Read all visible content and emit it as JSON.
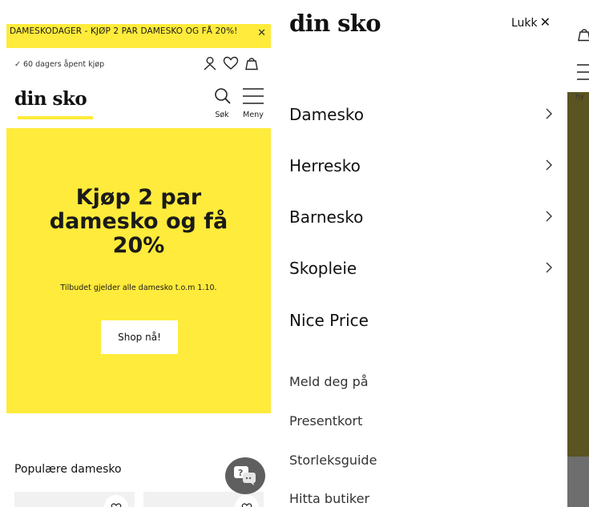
{
  "left_page": {
    "promo_banner": {
      "text": "DAMESKODAGER - KJØP 2 PAR DAMESKO OG FÅ 20%!",
      "close_glyph": "✕"
    },
    "trust_text": "60 dagers åpent kjøp",
    "trust_icon": "checkmark-icon",
    "header_icons": [
      "user-icon",
      "heart-icon",
      "bag-icon"
    ],
    "logo": "din sko",
    "search_label": "Søk",
    "menu_label": "Meny",
    "hero": {
      "title": "Kjøp 2 par damesko og få 20%",
      "subtitle": "Tilbudet gjelder alle damesko t.o.m 1.10.",
      "button": "Shop nå!"
    },
    "popular_heading": "Populære damesko"
  },
  "drawer": {
    "logo": "din sko",
    "close_label": "Lukk",
    "close_glyph": "✕",
    "primary_items": [
      {
        "label": "Damesko",
        "has_submenu": true
      },
      {
        "label": "Herresko",
        "has_submenu": true
      },
      {
        "label": "Barnesko",
        "has_submenu": true
      },
      {
        "label": "Skopleie",
        "has_submenu": true
      },
      {
        "label": "Nice Price",
        "has_submenu": false
      }
    ],
    "secondary_items": [
      {
        "label": "Meld deg på"
      },
      {
        "label": "Presentkort"
      },
      {
        "label": "Storleksguide"
      },
      {
        "label": "Hitta butiker"
      }
    ]
  },
  "right_sliver": {
    "meny_fragment": "ny"
  },
  "colors": {
    "brand_yellow": "#ffeb3b",
    "text": "#111111",
    "overlay": "#6e6e6e"
  }
}
